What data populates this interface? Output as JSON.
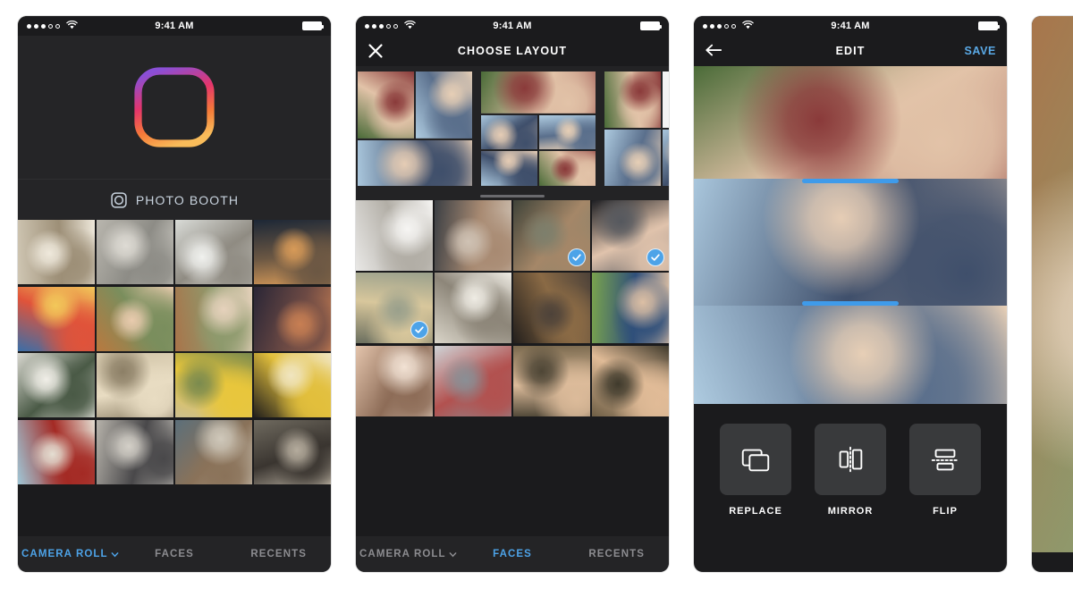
{
  "app": {
    "name": "Layout from Instagram",
    "accent_blue": "#4da3e8",
    "bg_dark": "#1b1b1d",
    "panel_dark": "#393a3c"
  },
  "status_bar": {
    "time": "9:41 AM",
    "signal_filled": 3,
    "signal_total": 5,
    "wifi_icon": "wifi-icon",
    "battery_icon": "battery-icon"
  },
  "screens": [
    {
      "id": "gallery",
      "nav": {
        "title": "",
        "left_icon": "",
        "right_action": ""
      },
      "hero": {
        "logo_icon": "layout-logo-icon"
      },
      "photo_booth": {
        "label": "PHOTO BOOTH",
        "icon": "camera-booth-icon"
      },
      "tabs": [
        {
          "label": "CAMERA ROLL",
          "active": true,
          "caret": "chevron-down-icon"
        },
        {
          "label": "FACES",
          "active": false,
          "caret": ""
        },
        {
          "label": "RECENTS",
          "active": false,
          "caret": ""
        }
      ]
    },
    {
      "id": "choose-layout",
      "nav": {
        "title": "CHOOSE LAYOUT",
        "left_icon": "close-icon",
        "right_action": ""
      },
      "carousel": {
        "option_count": 3,
        "scroll_indicator": true
      },
      "selected_count": 3,
      "check_icon": "checkmark-icon",
      "tabs": [
        {
          "label": "CAMERA ROLL",
          "active": false,
          "caret": "chevron-down-icon"
        },
        {
          "label": "FACES",
          "active": true,
          "caret": ""
        },
        {
          "label": "RECENTS",
          "active": false,
          "caret": ""
        }
      ]
    },
    {
      "id": "edit",
      "nav": {
        "title": "EDIT",
        "left_icon": "back-arrow-icon",
        "right_action": "SAVE"
      },
      "selected_panel_index": 1,
      "tools": [
        {
          "label": "REPLACE",
          "icon": "replace-icon"
        },
        {
          "label": "MIRROR",
          "icon": "mirror-icon"
        },
        {
          "label": "FLIP",
          "icon": "flip-icon"
        }
      ]
    },
    {
      "id": "preview-partial",
      "nav": {
        "title": "",
        "left_icon": "",
        "right_action": ""
      },
      "close_icon": "close-icon"
    }
  ],
  "gallery_photos": [
    "bulldog-on-rug",
    "two-hikers-on-rocks",
    "woman-sitting-on-cliff",
    "sunset-silhouette-beach",
    "colorful-balloons-sunset",
    "woman-in-hat-smiling",
    "two-women-sunglasses",
    "palm-trees-dusk",
    "child-by-window",
    "cupcakes-in-box",
    "woman-with-sunflower",
    "yellow-leaves-bicycle",
    "red-coffee-cup",
    "feet-on-pavement",
    "puppy-on-deck",
    "dog-under-bench"
  ],
  "faces_photos": [
    "woman-sunglasses-selfie",
    "couple-silly-faces",
    "three-friends-night",
    "man-dark-hair-portrait",
    "blonde-with-phone",
    "woman-striped-sweater",
    "group-at-bar",
    "two-women-green-wall",
    "girl-close-up",
    "classroom-group",
    "woman-peace-sign",
    "woman-outdoors-hand"
  ],
  "layout_photos": [
    "friends-lying-grass",
    "selfie-at-field",
    "friends-on-bleachers"
  ]
}
